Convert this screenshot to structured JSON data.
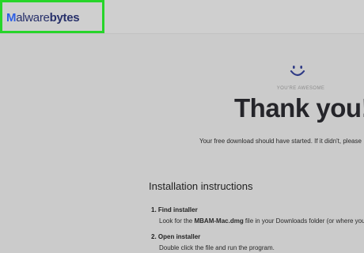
{
  "header": {
    "logo_prefix": "M",
    "logo_mid": "alware",
    "logo_suffix": "bytes"
  },
  "hero": {
    "icon": "smiley-icon",
    "tagline": "YOU'RE AWESOME",
    "title": "Thank you!",
    "message": "Your free download should have started. If it didn't, please"
  },
  "instructions": {
    "title": "Installation instructions",
    "steps": [
      {
        "number": "1.",
        "title": "Find installer",
        "text_before": "Look for the ",
        "file": "MBAM-Mac.dmg",
        "text_after": " file in your Downloads folder (or where you"
      },
      {
        "number": "2.",
        "title": "Open installer",
        "text": "Double click the file and run the program."
      }
    ]
  },
  "colors": {
    "background": "#cbcbcb",
    "highlight": "#27d52a",
    "brand_dark": "#27306a",
    "brand_blue": "#2d5ee5"
  }
}
